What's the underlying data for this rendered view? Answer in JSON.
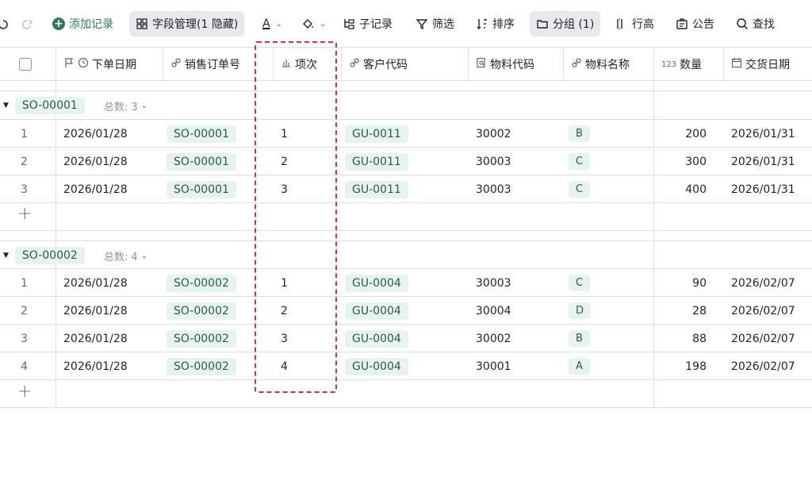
{
  "toolbar": {
    "add_record": "添加记录",
    "field_manage": "字段管理(1 隐藏)",
    "text_color": "A",
    "sub_record": "子记录",
    "filter": "筛选",
    "sort": "排序",
    "group": "分组 (1)",
    "row_height": "行高",
    "announcement": "公告",
    "search": "查找"
  },
  "columns": {
    "order_date": "下单日期",
    "sales_order": "销售订单号",
    "item_no": "项次",
    "customer_code": "客户代码",
    "material_code": "物料代码",
    "material_name": "物料名称",
    "quantity": "数量",
    "quantity_icon": "123",
    "delivery_date": "交货日期"
  },
  "groups": [
    {
      "name": "SO-00001",
      "count_label": "总数: 3",
      "rows": [
        {
          "idx": "1",
          "order_date": "2026/01/28",
          "sales_order": "SO-00001",
          "item_no": "1",
          "customer": "GU-0011",
          "material_code": "30002",
          "material_name": "B",
          "qty": "200",
          "delivery": "2026/01/31"
        },
        {
          "idx": "2",
          "order_date": "2026/01/28",
          "sales_order": "SO-00001",
          "item_no": "2",
          "customer": "GU-0011",
          "material_code": "30003",
          "material_name": "C",
          "qty": "300",
          "delivery": "2026/01/31"
        },
        {
          "idx": "3",
          "order_date": "2026/01/28",
          "sales_order": "SO-00001",
          "item_no": "3",
          "customer": "GU-0011",
          "material_code": "30003",
          "material_name": "C",
          "qty": "400",
          "delivery": "2026/01/31"
        }
      ]
    },
    {
      "name": "SO-00002",
      "count_label": "总数: 4",
      "rows": [
        {
          "idx": "1",
          "order_date": "2026/01/28",
          "sales_order": "SO-00002",
          "item_no": "1",
          "customer": "GU-0004",
          "material_code": "30003",
          "material_name": "C",
          "qty": "90",
          "delivery": "2026/02/07"
        },
        {
          "idx": "2",
          "order_date": "2026/01/28",
          "sales_order": "SO-00002",
          "item_no": "2",
          "customer": "GU-0004",
          "material_code": "30004",
          "material_name": "D",
          "qty": "28",
          "delivery": "2026/02/07"
        },
        {
          "idx": "3",
          "order_date": "2026/01/28",
          "sales_order": "SO-00002",
          "item_no": "3",
          "customer": "GU-0004",
          "material_code": "30002",
          "material_name": "B",
          "qty": "88",
          "delivery": "2026/02/07"
        },
        {
          "idx": "4",
          "order_date": "2026/01/28",
          "sales_order": "SO-00002",
          "item_no": "4",
          "customer": "GU-0004",
          "material_code": "30001",
          "material_name": "A",
          "qty": "198",
          "delivery": "2026/02/07"
        }
      ]
    }
  ],
  "colors": {
    "accent": "#2f7a5d",
    "tag_bg": "#e6f3ef",
    "highlight": "#e03131"
  }
}
